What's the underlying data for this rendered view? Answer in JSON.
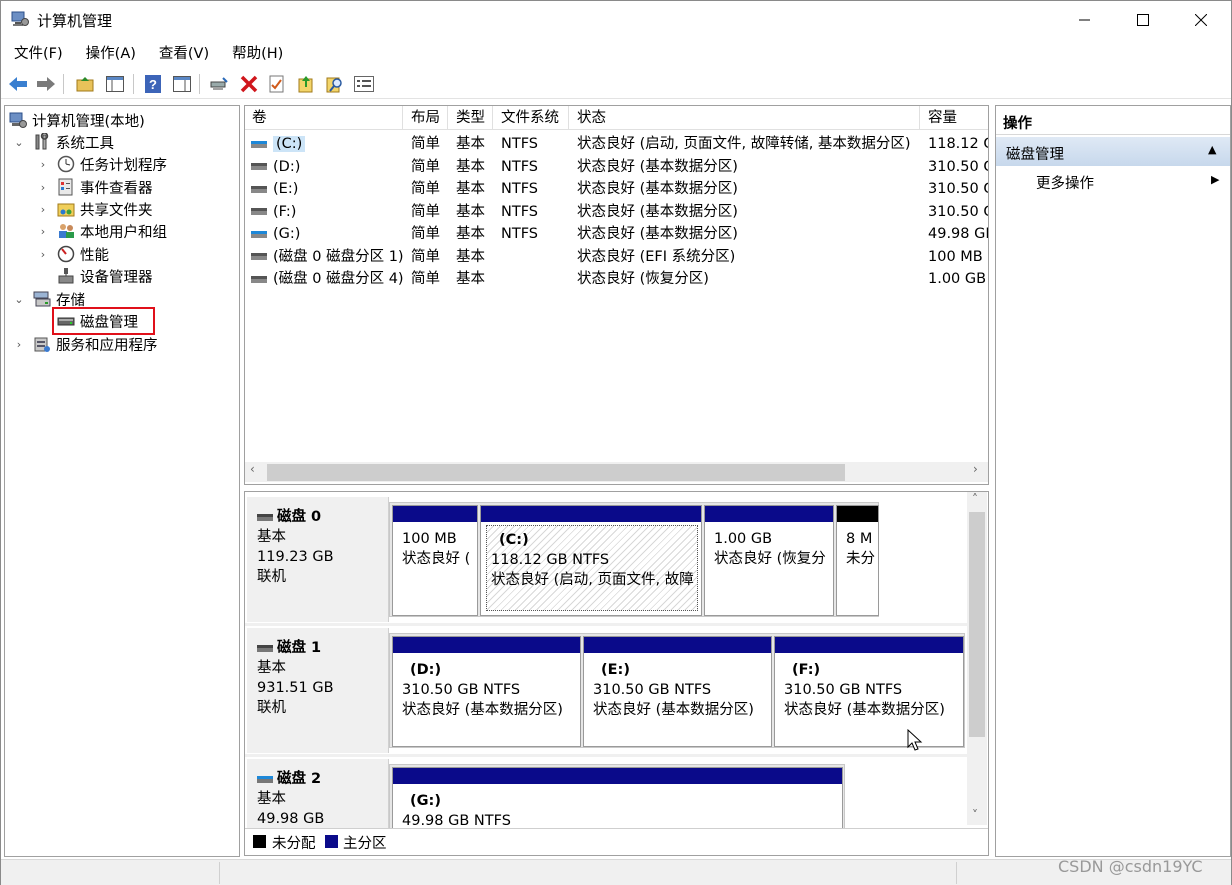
{
  "window": {
    "title": "计算机管理"
  },
  "menu": [
    "文件(F)",
    "操作(A)",
    "查看(V)",
    "帮助(H)"
  ],
  "toolbar_icons": [
    "back-icon",
    "forward-icon",
    "up-folder-icon",
    "console-tree-icon",
    "help-icon",
    "help-pane-icon",
    "connect-icon",
    "delete-icon",
    "properties-icon",
    "export-icon",
    "search-icon",
    "list-icon"
  ],
  "tree": {
    "root": "计算机管理(本地)",
    "system_tools": "系统工具",
    "task_scheduler": "任务计划程序",
    "event_viewer": "事件查看器",
    "shared_folders": "共享文件夹",
    "local_users": "本地用户和组",
    "performance": "性能",
    "device_manager": "设备管理器",
    "storage": "存储",
    "disk_management": "磁盘管理",
    "services": "服务和应用程序"
  },
  "volume_list": {
    "columns": [
      "卷",
      "布局",
      "类型",
      "文件系统",
      "状态",
      "容量"
    ],
    "rows": [
      {
        "volume": "(C:)",
        "layout": "简单",
        "type": "基本",
        "fs": "NTFS",
        "status": "状态良好 (启动, 页面文件, 故障转储, 基本数据分区)",
        "capacity": "118.12 G"
      },
      {
        "volume": "(D:)",
        "layout": "简单",
        "type": "基本",
        "fs": "NTFS",
        "status": "状态良好 (基本数据分区)",
        "capacity": "310.50 G"
      },
      {
        "volume": "(E:)",
        "layout": "简单",
        "type": "基本",
        "fs": "NTFS",
        "status": "状态良好 (基本数据分区)",
        "capacity": "310.50 G"
      },
      {
        "volume": "(F:)",
        "layout": "简单",
        "type": "基本",
        "fs": "NTFS",
        "status": "状态良好 (基本数据分区)",
        "capacity": "310.50 G"
      },
      {
        "volume": "(G:)",
        "layout": "简单",
        "type": "基本",
        "fs": "NTFS",
        "status": "状态良好 (基本数据分区)",
        "capacity": "49.98 GE"
      },
      {
        "volume": "(磁盘 0 磁盘分区 1)",
        "layout": "简单",
        "type": "基本",
        "fs": "",
        "status": "状态良好 (EFI 系统分区)",
        "capacity": "100 MB"
      },
      {
        "volume": "(磁盘 0 磁盘分区 4)",
        "layout": "简单",
        "type": "基本",
        "fs": "",
        "status": "状态良好 (恢复分区)",
        "capacity": "1.00 GB"
      }
    ]
  },
  "disks": [
    {
      "name": "磁盘 0",
      "type": "基本",
      "size": "119.23 GB",
      "state": "联机",
      "partitions": [
        {
          "letter": "",
          "size": "100 MB",
          "status": "状态良好 ("
        },
        {
          "letter": "(C:)",
          "size": "118.12 GB NTFS",
          "status": "状态良好 (启动, 页面文件, 故障"
        },
        {
          "letter": "",
          "size": "1.00 GB",
          "status": "状态良好 (恢复分"
        },
        {
          "letter": "",
          "size": "8 M",
          "status": "未分"
        }
      ]
    },
    {
      "name": "磁盘 1",
      "type": "基本",
      "size": "931.51 GB",
      "state": "联机",
      "partitions": [
        {
          "letter": "(D:)",
          "size": "310.50 GB NTFS",
          "status": "状态良好 (基本数据分区)"
        },
        {
          "letter": "(E:)",
          "size": "310.50 GB NTFS",
          "status": "状态良好 (基本数据分区)"
        },
        {
          "letter": "(F:)",
          "size": "310.50 GB NTFS",
          "status": "状态良好 (基本数据分区)"
        }
      ]
    },
    {
      "name": "磁盘 2",
      "type": "基本",
      "size": "49.98 GB",
      "state": "",
      "partitions": [
        {
          "letter": "(G:)",
          "size": "49.98 GB NTFS",
          "status": ""
        }
      ]
    }
  ],
  "legend": {
    "unallocated": "未分配",
    "primary": "主分区"
  },
  "colors": {
    "primary": "#0a0a8a",
    "unallocated": "#000000",
    "selection": "#cce4f7",
    "highlight_box": "#e0101a"
  },
  "actions": {
    "header": "操作",
    "section": "磁盘管理",
    "more": "更多操作"
  },
  "watermark": "CSDN @csdn19YC"
}
